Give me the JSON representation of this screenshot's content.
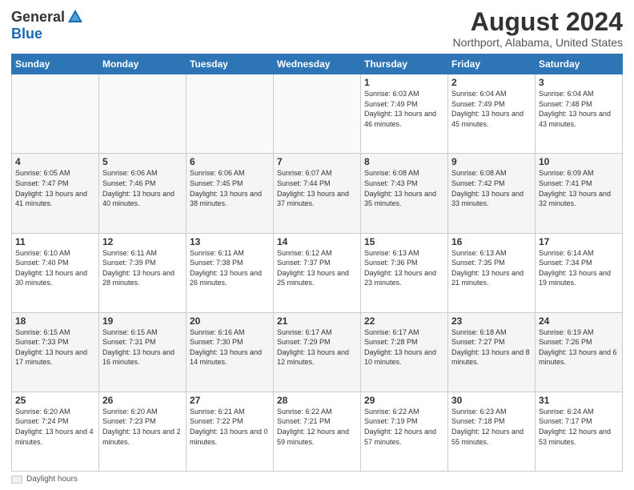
{
  "header": {
    "logo_general": "General",
    "logo_blue": "Blue",
    "title": "August 2024",
    "subtitle": "Northport, Alabama, United States"
  },
  "days_of_week": [
    "Sunday",
    "Monday",
    "Tuesday",
    "Wednesday",
    "Thursday",
    "Friday",
    "Saturday"
  ],
  "weeks": [
    [
      {
        "day": "",
        "info": "",
        "empty": true
      },
      {
        "day": "",
        "info": "",
        "empty": true
      },
      {
        "day": "",
        "info": "",
        "empty": true
      },
      {
        "day": "",
        "info": "",
        "empty": true
      },
      {
        "day": "1",
        "info": "Sunrise: 6:03 AM\nSunset: 7:49 PM\nDaylight: 13 hours\nand 46 minutes.",
        "empty": false
      },
      {
        "day": "2",
        "info": "Sunrise: 6:04 AM\nSunset: 7:49 PM\nDaylight: 13 hours\nand 45 minutes.",
        "empty": false
      },
      {
        "day": "3",
        "info": "Sunrise: 6:04 AM\nSunset: 7:48 PM\nDaylight: 13 hours\nand 43 minutes.",
        "empty": false
      }
    ],
    [
      {
        "day": "4",
        "info": "Sunrise: 6:05 AM\nSunset: 7:47 PM\nDaylight: 13 hours\nand 41 minutes.",
        "empty": false
      },
      {
        "day": "5",
        "info": "Sunrise: 6:06 AM\nSunset: 7:46 PM\nDaylight: 13 hours\nand 40 minutes.",
        "empty": false
      },
      {
        "day": "6",
        "info": "Sunrise: 6:06 AM\nSunset: 7:45 PM\nDaylight: 13 hours\nand 38 minutes.",
        "empty": false
      },
      {
        "day": "7",
        "info": "Sunrise: 6:07 AM\nSunset: 7:44 PM\nDaylight: 13 hours\nand 37 minutes.",
        "empty": false
      },
      {
        "day": "8",
        "info": "Sunrise: 6:08 AM\nSunset: 7:43 PM\nDaylight: 13 hours\nand 35 minutes.",
        "empty": false
      },
      {
        "day": "9",
        "info": "Sunrise: 6:08 AM\nSunset: 7:42 PM\nDaylight: 13 hours\nand 33 minutes.",
        "empty": false
      },
      {
        "day": "10",
        "info": "Sunrise: 6:09 AM\nSunset: 7:41 PM\nDaylight: 13 hours\nand 32 minutes.",
        "empty": false
      }
    ],
    [
      {
        "day": "11",
        "info": "Sunrise: 6:10 AM\nSunset: 7:40 PM\nDaylight: 13 hours\nand 30 minutes.",
        "empty": false
      },
      {
        "day": "12",
        "info": "Sunrise: 6:11 AM\nSunset: 7:39 PM\nDaylight: 13 hours\nand 28 minutes.",
        "empty": false
      },
      {
        "day": "13",
        "info": "Sunrise: 6:11 AM\nSunset: 7:38 PM\nDaylight: 13 hours\nand 26 minutes.",
        "empty": false
      },
      {
        "day": "14",
        "info": "Sunrise: 6:12 AM\nSunset: 7:37 PM\nDaylight: 13 hours\nand 25 minutes.",
        "empty": false
      },
      {
        "day": "15",
        "info": "Sunrise: 6:13 AM\nSunset: 7:36 PM\nDaylight: 13 hours\nand 23 minutes.",
        "empty": false
      },
      {
        "day": "16",
        "info": "Sunrise: 6:13 AM\nSunset: 7:35 PM\nDaylight: 13 hours\nand 21 minutes.",
        "empty": false
      },
      {
        "day": "17",
        "info": "Sunrise: 6:14 AM\nSunset: 7:34 PM\nDaylight: 13 hours\nand 19 minutes.",
        "empty": false
      }
    ],
    [
      {
        "day": "18",
        "info": "Sunrise: 6:15 AM\nSunset: 7:33 PM\nDaylight: 13 hours\nand 17 minutes.",
        "empty": false
      },
      {
        "day": "19",
        "info": "Sunrise: 6:15 AM\nSunset: 7:31 PM\nDaylight: 13 hours\nand 16 minutes.",
        "empty": false
      },
      {
        "day": "20",
        "info": "Sunrise: 6:16 AM\nSunset: 7:30 PM\nDaylight: 13 hours\nand 14 minutes.",
        "empty": false
      },
      {
        "day": "21",
        "info": "Sunrise: 6:17 AM\nSunset: 7:29 PM\nDaylight: 13 hours\nand 12 minutes.",
        "empty": false
      },
      {
        "day": "22",
        "info": "Sunrise: 6:17 AM\nSunset: 7:28 PM\nDaylight: 13 hours\nand 10 minutes.",
        "empty": false
      },
      {
        "day": "23",
        "info": "Sunrise: 6:18 AM\nSunset: 7:27 PM\nDaylight: 13 hours\nand 8 minutes.",
        "empty": false
      },
      {
        "day": "24",
        "info": "Sunrise: 6:19 AM\nSunset: 7:26 PM\nDaylight: 13 hours\nand 6 minutes.",
        "empty": false
      }
    ],
    [
      {
        "day": "25",
        "info": "Sunrise: 6:20 AM\nSunset: 7:24 PM\nDaylight: 13 hours\nand 4 minutes.",
        "empty": false
      },
      {
        "day": "26",
        "info": "Sunrise: 6:20 AM\nSunset: 7:23 PM\nDaylight: 13 hours\nand 2 minutes.",
        "empty": false
      },
      {
        "day": "27",
        "info": "Sunrise: 6:21 AM\nSunset: 7:22 PM\nDaylight: 13 hours\nand 0 minutes.",
        "empty": false
      },
      {
        "day": "28",
        "info": "Sunrise: 6:22 AM\nSunset: 7:21 PM\nDaylight: 12 hours\nand 59 minutes.",
        "empty": false
      },
      {
        "day": "29",
        "info": "Sunrise: 6:22 AM\nSunset: 7:19 PM\nDaylight: 12 hours\nand 57 minutes.",
        "empty": false
      },
      {
        "day": "30",
        "info": "Sunrise: 6:23 AM\nSunset: 7:18 PM\nDaylight: 12 hours\nand 55 minutes.",
        "empty": false
      },
      {
        "day": "31",
        "info": "Sunrise: 6:24 AM\nSunset: 7:17 PM\nDaylight: 12 hours\nand 53 minutes.",
        "empty": false
      }
    ]
  ],
  "footer": {
    "daylight_label": "Daylight hours"
  }
}
